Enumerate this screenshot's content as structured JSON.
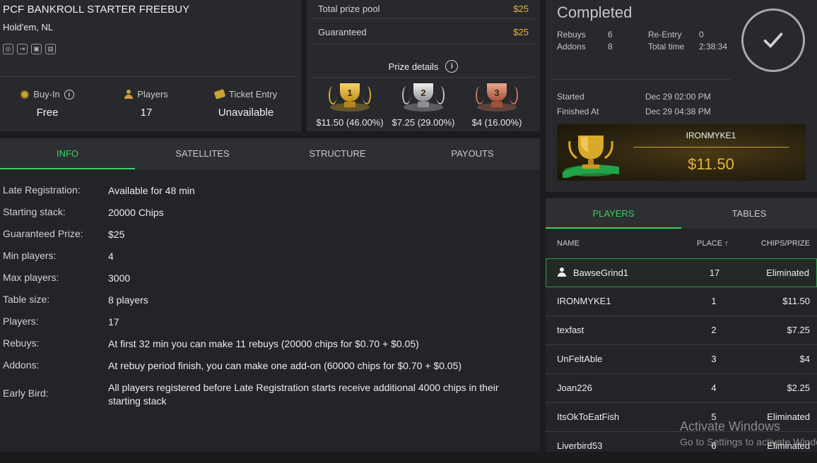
{
  "tournament": {
    "title": "PCF BANKROLL STARTER FREEBUY",
    "game": "Hold'em, NL",
    "feature_icons": [
      "chip-icon",
      "exit-icon",
      "lock-icon",
      "ticket-icon"
    ],
    "buyin_label": "Buy-In",
    "buyin_value": "Free",
    "players_label": "Players",
    "players_value": "17",
    "ticket_label": "Ticket Entry",
    "ticket_value": "Unavailable"
  },
  "prizes": {
    "total_label": "Total prize pool",
    "total_value": "$25",
    "guaranteed_label": "Guaranteed",
    "guaranteed_value": "$25",
    "details_label": "Prize details",
    "places": [
      {
        "place": "1",
        "amount": "$11.50 (46.00%)",
        "color": "#d9a92c"
      },
      {
        "place": "2",
        "amount": "$7.25 (29.00%)",
        "color": "#bfc0c2"
      },
      {
        "place": "3",
        "amount": "$4 (16.00%)",
        "color": "#c9745a"
      }
    ]
  },
  "summary": {
    "status": "Completed",
    "rebuys_label": "Rebuys",
    "rebuys_value": "6",
    "addons_label": "Addons",
    "addons_value": "8",
    "reentry_label": "Re-Entry",
    "reentry_value": "0",
    "totaltime_label": "Total time",
    "totaltime_value": "2:38:34",
    "started_label": "Started",
    "started_value": "Dec 29 02:00 PM",
    "finished_label": "Finished At",
    "finished_value": "Dec 29 04:38 PM",
    "winner_name": "IRONMYKE1",
    "winner_prize": "$11.50"
  },
  "tabs": [
    "INFO",
    "SATELLITES",
    "STRUCTURE",
    "PAYOUTS"
  ],
  "info": [
    {
      "k": "Late Registration:",
      "v": "Available for 48 min"
    },
    {
      "k": "Starting stack:",
      "v": "20000 Chips"
    },
    {
      "k": "Guaranteed Prize:",
      "v": "$25"
    },
    {
      "k": "Min players:",
      "v": "4"
    },
    {
      "k": "Max players:",
      "v": "3000"
    },
    {
      "k": "Table size:",
      "v": "8 players"
    },
    {
      "k": "Players:",
      "v": "17"
    },
    {
      "k": "Rebuys:",
      "v": "At first 32 min you can make 11 rebuys (20000 chips for $0.70 + $0.05)"
    },
    {
      "k": "Addons:",
      "v": "At rebuy period finish, you can make one add-on (60000 chips for $0.70 + $0.05)"
    },
    {
      "k": "Early Bird:",
      "v": "All players registered before Late Registration starts receive additional 4000 chips in their starting stack"
    }
  ],
  "players_panel": {
    "tabs": [
      "PLAYERS",
      "TABLES"
    ],
    "col_name": "NAME",
    "col_place": "PLACE ↑",
    "col_prize": "CHIPS/PRIZE",
    "rows": [
      {
        "name": "BawseGrind1",
        "place": "17",
        "prize": "Eliminated"
      },
      {
        "name": "IRONMYKE1",
        "place": "1",
        "prize": "$11.50"
      },
      {
        "name": "texfast",
        "place": "2",
        "prize": "$7.25"
      },
      {
        "name": "UnFeltAble",
        "place": "3",
        "prize": "$4"
      },
      {
        "name": "Joan226",
        "place": "4",
        "prize": "$2.25"
      },
      {
        "name": "ItsOkToEatFish",
        "place": "5",
        "prize": "Eliminated"
      },
      {
        "name": "Liverbird53",
        "place": "6",
        "prize": "Eliminated"
      }
    ]
  },
  "watermark": {
    "line1": "Activate Windows",
    "line2": "Go to Settings to activate Windows."
  },
  "colors": {
    "accent_green": "#3bd15c",
    "gold": "#e8b33a",
    "panel": "#27292c"
  }
}
